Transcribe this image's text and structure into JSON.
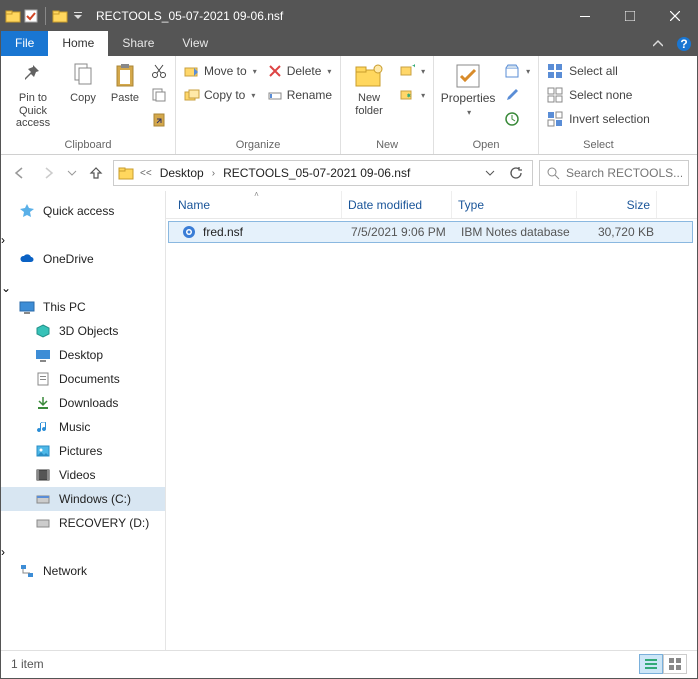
{
  "window": {
    "title": "RECTOOLS_05-07-2021 09-06.nsf"
  },
  "tabs": {
    "file": "File",
    "home": "Home",
    "share": "Share",
    "view": "View"
  },
  "ribbon": {
    "clipboard": {
      "label": "Clipboard",
      "pin": "Pin to Quick\naccess",
      "copy": "Copy",
      "paste": "Paste"
    },
    "organize": {
      "label": "Organize",
      "moveto": "Move to",
      "copyto": "Copy to",
      "delete": "Delete",
      "rename": "Rename"
    },
    "new": {
      "label": "New",
      "newfolder": "New\nfolder"
    },
    "open": {
      "label": "Open",
      "properties": "Properties"
    },
    "select": {
      "label": "Select",
      "all": "Select all",
      "none": "Select none",
      "invert": "Invert selection"
    }
  },
  "breadcrumbs": {
    "items": [
      "Desktop",
      "RECTOOLS_05-07-2021 09-06.nsf"
    ]
  },
  "search": {
    "placeholder": "Search RECTOOLS..."
  },
  "sidebar": {
    "quickaccess": "Quick access",
    "onedrive": "OneDrive",
    "thispc": "This PC",
    "objects3d": "3D Objects",
    "desktop": "Desktop",
    "documents": "Documents",
    "downloads": "Downloads",
    "music": "Music",
    "pictures": "Pictures",
    "videos": "Videos",
    "windowsc": "Windows (C:)",
    "recoveryd": "RECOVERY (D:)",
    "network": "Network"
  },
  "columns": {
    "name": "Name",
    "date": "Date modified",
    "type": "Type",
    "size": "Size"
  },
  "files": [
    {
      "name": "fred.nsf",
      "date": "7/5/2021 9:06 PM",
      "type": "IBM Notes database",
      "size": "30,720 KB"
    }
  ],
  "status": {
    "count": "1 item"
  }
}
